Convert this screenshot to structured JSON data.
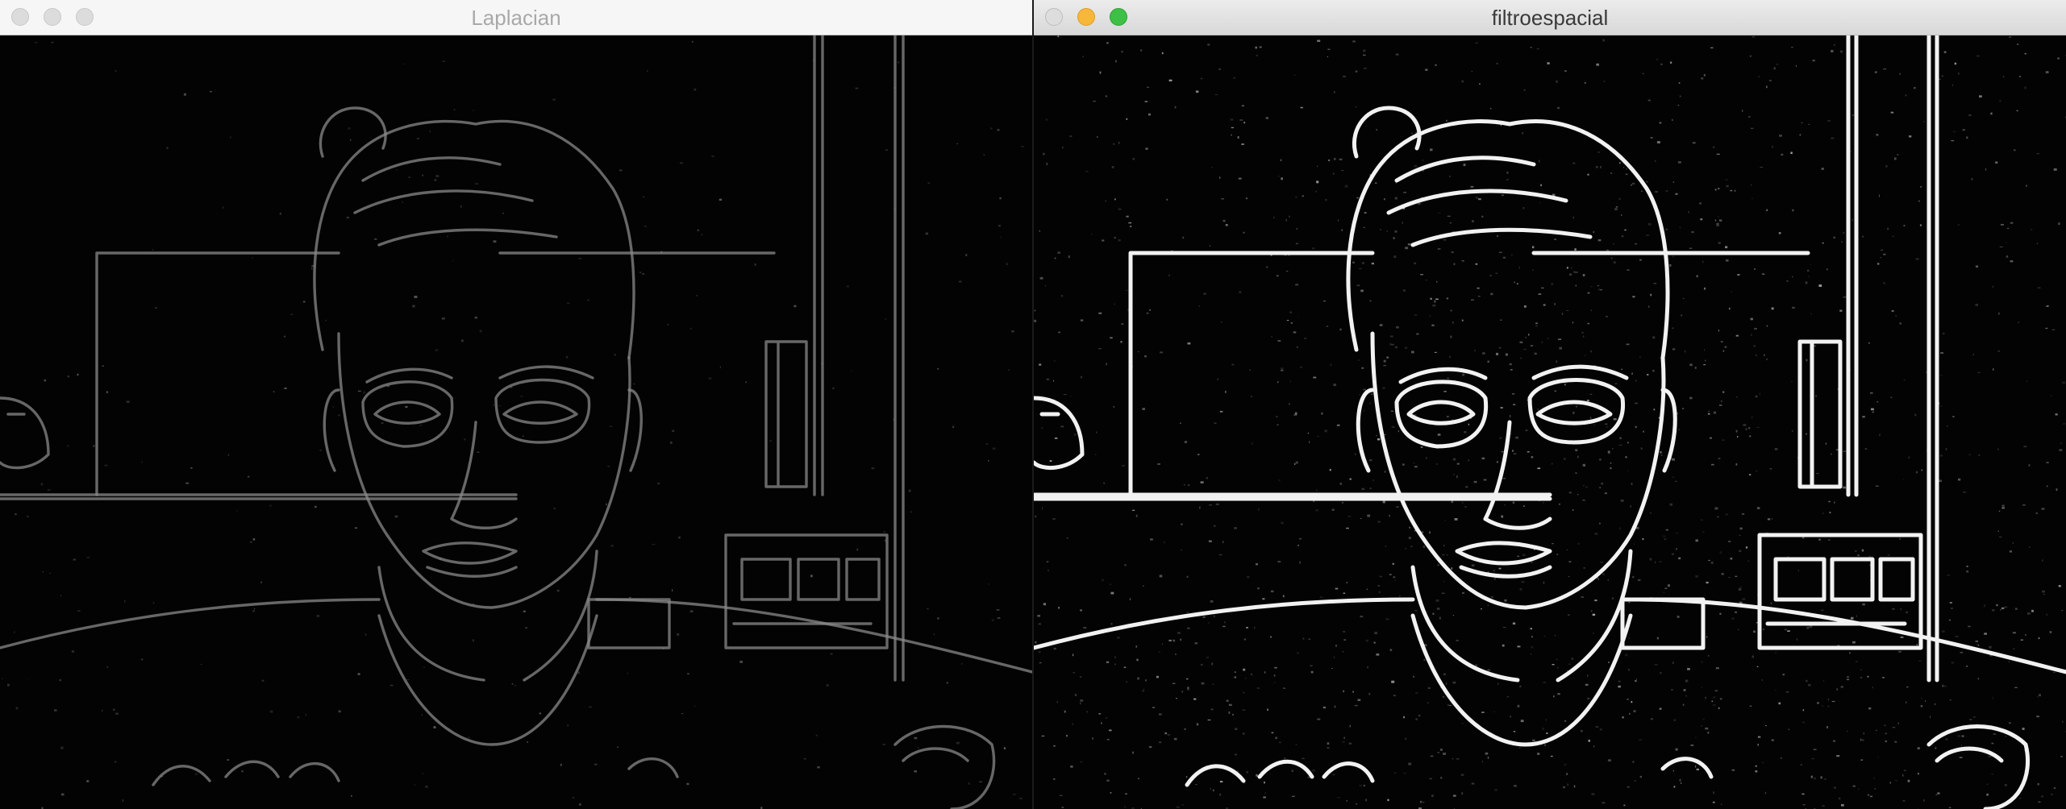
{
  "windows": [
    {
      "title": "Laplacian",
      "state": "inactive",
      "image": {
        "subject": "laplacian-edge-response",
        "edge_color": "#8a8a8a",
        "edge_intensity": 0.45,
        "noise_density": 0.15
      }
    },
    {
      "title": "filtroespacial",
      "state": "active",
      "image": {
        "subject": "spatial-filter-edge-response",
        "edge_color": "#f2f2f2",
        "edge_intensity": 1.0,
        "noise_density": 0.85
      }
    }
  ],
  "colors": {
    "close": "#dddddd",
    "minimize": "#f6b73b",
    "maximize": "#3ebf46",
    "inactive_button": "#dcdcdc"
  }
}
